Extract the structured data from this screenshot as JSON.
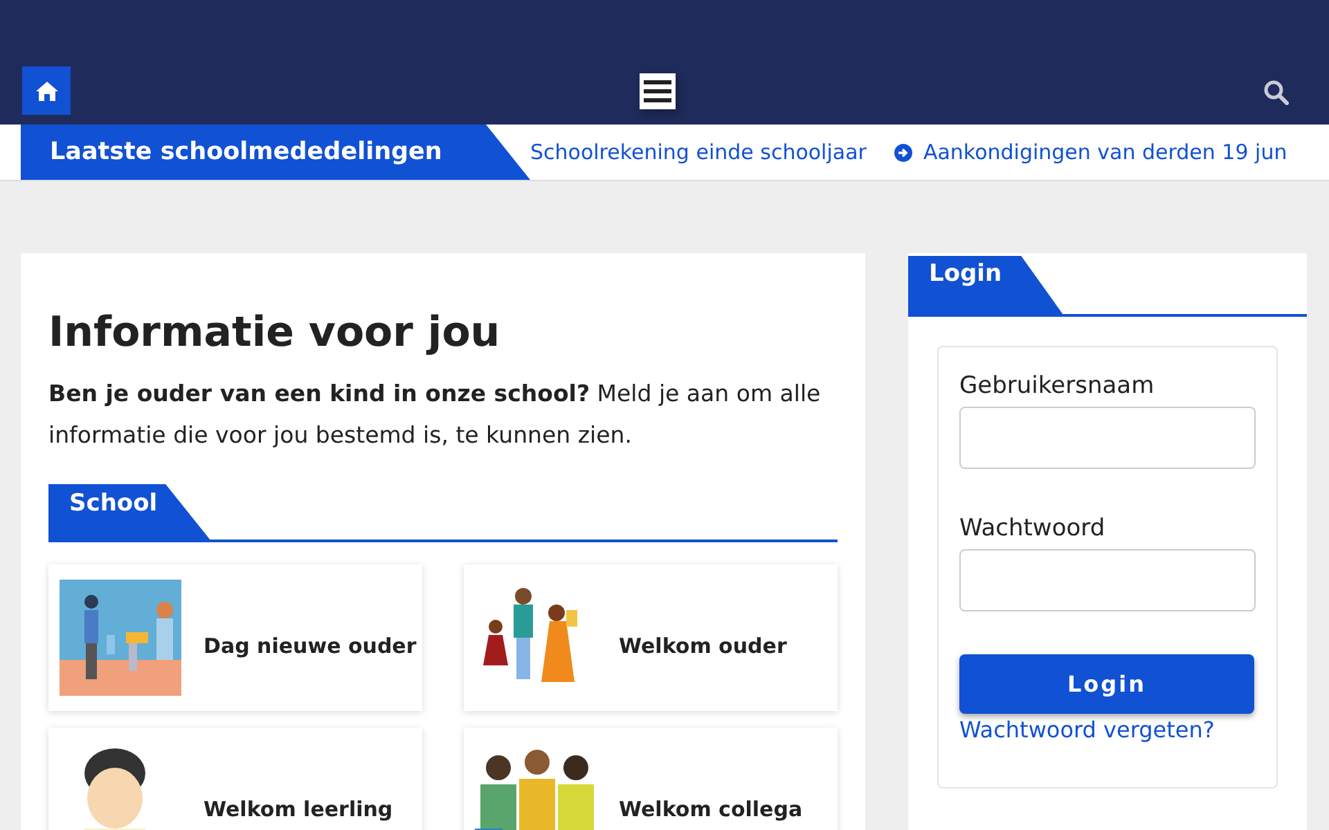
{
  "header": {
    "menu_open": false
  },
  "ticker": {
    "label": "Laatste schoolmededelingen",
    "items": [
      {
        "text": "Schoolrekening einde schooljaar",
        "icon": false
      },
      {
        "text": "Aankondigingen van derden 19 jun",
        "icon": true
      }
    ]
  },
  "main": {
    "title": "Informatie voor jou",
    "intro": "**Ben je ouder van een kind in onze school?** Meld je aan om alle informatie die voor jou bestemd is, te kunnen zien.",
    "section": "School",
    "cards": [
      {
        "title": "Dag nieuwe ouder",
        "kind": "picture"
      },
      {
        "title": "Welkom ouder",
        "kind": "picture"
      },
      {
        "title": "Welkom leerling",
        "kind": "picture"
      },
      {
        "title": "Welkom collega",
        "kind": "picture"
      }
    ]
  },
  "login": {
    "heading": "Login",
    "username_label": "Gebruikersnaam",
    "password_label": "Wachtwoord",
    "button": "Login",
    "forgot_link": "Wachtwoord vergeten?"
  }
}
